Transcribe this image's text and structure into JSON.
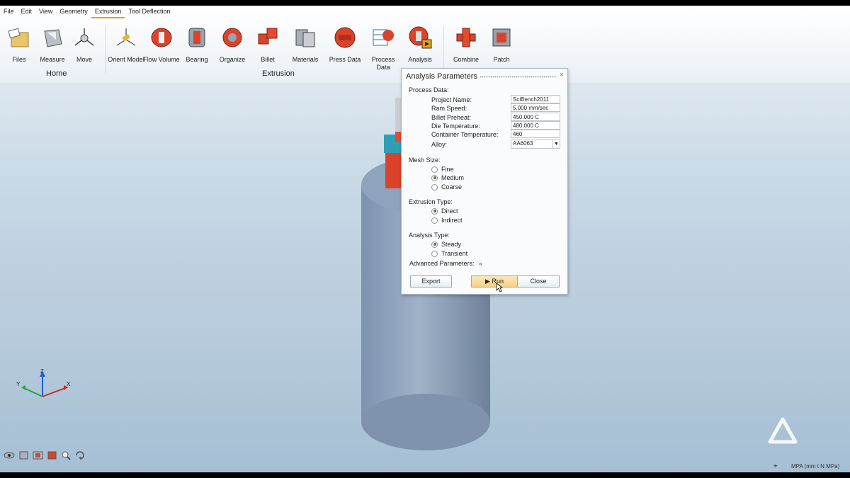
{
  "menu": [
    "File",
    "Edit",
    "View",
    "Geometry",
    "Extrusion",
    "Tool Deflection"
  ],
  "menu_active": "Extrusion",
  "ribbon": {
    "home_tools": [
      "Files",
      "Measure",
      "Move"
    ],
    "extrusion_tools": [
      "Orient Model",
      "Flow Volume",
      "Bearing",
      "Organize",
      "Billet",
      "Materials",
      "Press Data",
      "Process Data",
      "Analysis"
    ],
    "other_tools": [
      "Combine",
      "Patch"
    ],
    "groups": {
      "home": "Home",
      "extrusion": "Extrusion"
    }
  },
  "dialog": {
    "title": "Analysis Parameters",
    "process_data_label": "Process Data:",
    "fields": [
      {
        "label": "Project Name:",
        "value": "SciBench2011"
      },
      {
        "label": "Ram Speed:",
        "value": "5.000 mm/sec"
      },
      {
        "label": "Billet Preheat:",
        "value": "450.000 C"
      },
      {
        "label": "Die Temperature:",
        "value": "480.000 C"
      },
      {
        "label": "Container Temperature:",
        "value": "460"
      },
      {
        "label": "Alloy:",
        "value": "AA6063"
      }
    ],
    "mesh_size": {
      "label": "Mesh Size:",
      "options": [
        "Fine",
        "Medium",
        "Coarse"
      ],
      "selected": "Medium"
    },
    "extrusion_type": {
      "label": "Extrusion Type:",
      "options": [
        "Direct",
        "Indirect"
      ],
      "selected": "Direct"
    },
    "analysis_type": {
      "label": "Analysis Type:",
      "options": [
        "Steady",
        "Transient"
      ],
      "selected": "Steady"
    },
    "advanced_label": "Advanced Parameters:",
    "advanced_icon": "double-chevron-down-icon",
    "buttons": {
      "export": "Export",
      "run": "Run",
      "close": "Close"
    }
  },
  "statusbar": {
    "units": "MPA (mm t N MPa)"
  },
  "axes": {
    "z": "Z",
    "x": "X",
    "y": "Y"
  },
  "colors": {
    "accent": "#e0a020",
    "model_red": "#d9432b",
    "model_teal": "#2e9fb5",
    "cylinder": "#8fa3bc",
    "run_button": "#f4d189"
  }
}
